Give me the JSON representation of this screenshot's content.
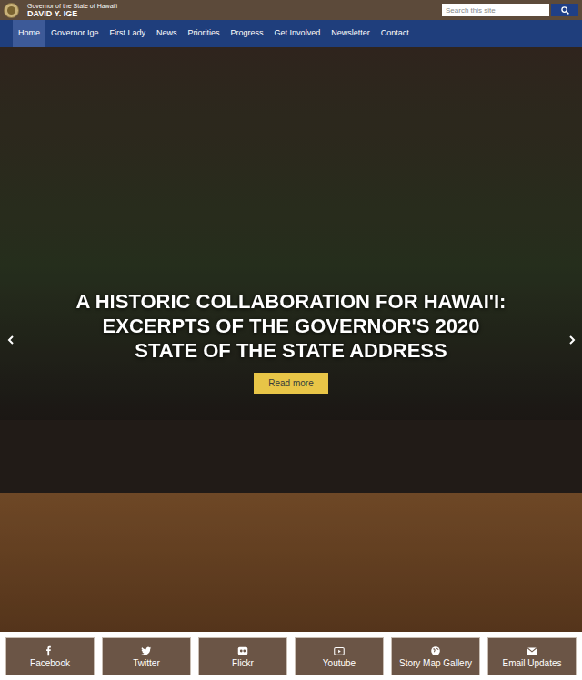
{
  "header": {
    "subtitle": "Governor of the State of Hawai'i",
    "title": "DAVID Y. IGE"
  },
  "search": {
    "placeholder": "Search this site"
  },
  "nav": [
    {
      "label": "Home",
      "selected": true
    },
    {
      "label": "Governor Ige",
      "selected": false
    },
    {
      "label": "First Lady",
      "selected": false
    },
    {
      "label": "News",
      "selected": false
    },
    {
      "label": "Priorities",
      "selected": false
    },
    {
      "label": "Progress",
      "selected": false
    },
    {
      "label": "Get Involved",
      "selected": false
    },
    {
      "label": "Newsletter",
      "selected": false
    },
    {
      "label": "Contact",
      "selected": false
    }
  ],
  "hero": {
    "title": "A HISTORIC COLLABORATION FOR HAWAI'I: EXCERPTS OF THE GOVERNOR'S 2020 STATE OF THE STATE ADDRESS",
    "button": "Read more"
  },
  "social": [
    {
      "label": "Facebook"
    },
    {
      "label": "Twitter"
    },
    {
      "label": "Flickr"
    },
    {
      "label": "Youtube"
    },
    {
      "label": "Story Map Gallery"
    },
    {
      "label": "Email Updates"
    }
  ]
}
